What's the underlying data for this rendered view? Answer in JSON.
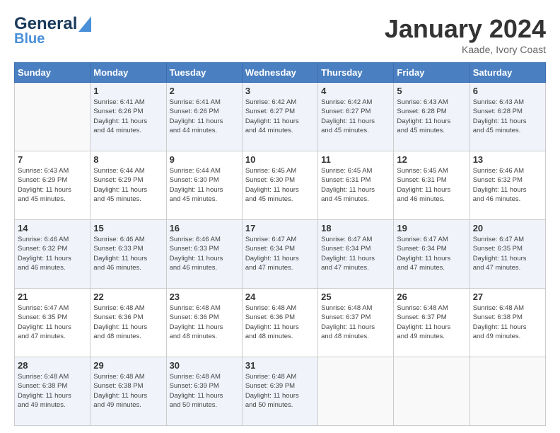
{
  "header": {
    "logo_line1": "General",
    "logo_line2": "Blue",
    "month_title": "January 2024",
    "location": "Kaade, Ivory Coast"
  },
  "weekdays": [
    "Sunday",
    "Monday",
    "Tuesday",
    "Wednesday",
    "Thursday",
    "Friday",
    "Saturday"
  ],
  "weeks": [
    [
      {
        "day": "",
        "sunrise": "",
        "sunset": "",
        "daylight": ""
      },
      {
        "day": "1",
        "sunrise": "Sunrise: 6:41 AM",
        "sunset": "Sunset: 6:26 PM",
        "daylight": "Daylight: 11 hours and 44 minutes."
      },
      {
        "day": "2",
        "sunrise": "Sunrise: 6:41 AM",
        "sunset": "Sunset: 6:26 PM",
        "daylight": "Daylight: 11 hours and 44 minutes."
      },
      {
        "day": "3",
        "sunrise": "Sunrise: 6:42 AM",
        "sunset": "Sunset: 6:27 PM",
        "daylight": "Daylight: 11 hours and 44 minutes."
      },
      {
        "day": "4",
        "sunrise": "Sunrise: 6:42 AM",
        "sunset": "Sunset: 6:27 PM",
        "daylight": "Daylight: 11 hours and 45 minutes."
      },
      {
        "day": "5",
        "sunrise": "Sunrise: 6:43 AM",
        "sunset": "Sunset: 6:28 PM",
        "daylight": "Daylight: 11 hours and 45 minutes."
      },
      {
        "day": "6",
        "sunrise": "Sunrise: 6:43 AM",
        "sunset": "Sunset: 6:28 PM",
        "daylight": "Daylight: 11 hours and 45 minutes."
      }
    ],
    [
      {
        "day": "7",
        "sunrise": "Sunrise: 6:43 AM",
        "sunset": "Sunset: 6:29 PM",
        "daylight": "Daylight: 11 hours and 45 minutes."
      },
      {
        "day": "8",
        "sunrise": "Sunrise: 6:44 AM",
        "sunset": "Sunset: 6:29 PM",
        "daylight": "Daylight: 11 hours and 45 minutes."
      },
      {
        "day": "9",
        "sunrise": "Sunrise: 6:44 AM",
        "sunset": "Sunset: 6:30 PM",
        "daylight": "Daylight: 11 hours and 45 minutes."
      },
      {
        "day": "10",
        "sunrise": "Sunrise: 6:45 AM",
        "sunset": "Sunset: 6:30 PM",
        "daylight": "Daylight: 11 hours and 45 minutes."
      },
      {
        "day": "11",
        "sunrise": "Sunrise: 6:45 AM",
        "sunset": "Sunset: 6:31 PM",
        "daylight": "Daylight: 11 hours and 45 minutes."
      },
      {
        "day": "12",
        "sunrise": "Sunrise: 6:45 AM",
        "sunset": "Sunset: 6:31 PM",
        "daylight": "Daylight: 11 hours and 46 minutes."
      },
      {
        "day": "13",
        "sunrise": "Sunrise: 6:46 AM",
        "sunset": "Sunset: 6:32 PM",
        "daylight": "Daylight: 11 hours and 46 minutes."
      }
    ],
    [
      {
        "day": "14",
        "sunrise": "Sunrise: 6:46 AM",
        "sunset": "Sunset: 6:32 PM",
        "daylight": "Daylight: 11 hours and 46 minutes."
      },
      {
        "day": "15",
        "sunrise": "Sunrise: 6:46 AM",
        "sunset": "Sunset: 6:33 PM",
        "daylight": "Daylight: 11 hours and 46 minutes."
      },
      {
        "day": "16",
        "sunrise": "Sunrise: 6:46 AM",
        "sunset": "Sunset: 6:33 PM",
        "daylight": "Daylight: 11 hours and 46 minutes."
      },
      {
        "day": "17",
        "sunrise": "Sunrise: 6:47 AM",
        "sunset": "Sunset: 6:34 PM",
        "daylight": "Daylight: 11 hours and 47 minutes."
      },
      {
        "day": "18",
        "sunrise": "Sunrise: 6:47 AM",
        "sunset": "Sunset: 6:34 PM",
        "daylight": "Daylight: 11 hours and 47 minutes."
      },
      {
        "day": "19",
        "sunrise": "Sunrise: 6:47 AM",
        "sunset": "Sunset: 6:34 PM",
        "daylight": "Daylight: 11 hours and 47 minutes."
      },
      {
        "day": "20",
        "sunrise": "Sunrise: 6:47 AM",
        "sunset": "Sunset: 6:35 PM",
        "daylight": "Daylight: 11 hours and 47 minutes."
      }
    ],
    [
      {
        "day": "21",
        "sunrise": "Sunrise: 6:47 AM",
        "sunset": "Sunset: 6:35 PM",
        "daylight": "Daylight: 11 hours and 47 minutes."
      },
      {
        "day": "22",
        "sunrise": "Sunrise: 6:48 AM",
        "sunset": "Sunset: 6:36 PM",
        "daylight": "Daylight: 11 hours and 48 minutes."
      },
      {
        "day": "23",
        "sunrise": "Sunrise: 6:48 AM",
        "sunset": "Sunset: 6:36 PM",
        "daylight": "Daylight: 11 hours and 48 minutes."
      },
      {
        "day": "24",
        "sunrise": "Sunrise: 6:48 AM",
        "sunset": "Sunset: 6:36 PM",
        "daylight": "Daylight: 11 hours and 48 minutes."
      },
      {
        "day": "25",
        "sunrise": "Sunrise: 6:48 AM",
        "sunset": "Sunset: 6:37 PM",
        "daylight": "Daylight: 11 hours and 48 minutes."
      },
      {
        "day": "26",
        "sunrise": "Sunrise: 6:48 AM",
        "sunset": "Sunset: 6:37 PM",
        "daylight": "Daylight: 11 hours and 49 minutes."
      },
      {
        "day": "27",
        "sunrise": "Sunrise: 6:48 AM",
        "sunset": "Sunset: 6:38 PM",
        "daylight": "Daylight: 11 hours and 49 minutes."
      }
    ],
    [
      {
        "day": "28",
        "sunrise": "Sunrise: 6:48 AM",
        "sunset": "Sunset: 6:38 PM",
        "daylight": "Daylight: 11 hours and 49 minutes."
      },
      {
        "day": "29",
        "sunrise": "Sunrise: 6:48 AM",
        "sunset": "Sunset: 6:38 PM",
        "daylight": "Daylight: 11 hours and 49 minutes."
      },
      {
        "day": "30",
        "sunrise": "Sunrise: 6:48 AM",
        "sunset": "Sunset: 6:39 PM",
        "daylight": "Daylight: 11 hours and 50 minutes."
      },
      {
        "day": "31",
        "sunrise": "Sunrise: 6:48 AM",
        "sunset": "Sunset: 6:39 PM",
        "daylight": "Daylight: 11 hours and 50 minutes."
      },
      {
        "day": "",
        "sunrise": "",
        "sunset": "",
        "daylight": ""
      },
      {
        "day": "",
        "sunrise": "",
        "sunset": "",
        "daylight": ""
      },
      {
        "day": "",
        "sunrise": "",
        "sunset": "",
        "daylight": ""
      }
    ]
  ]
}
